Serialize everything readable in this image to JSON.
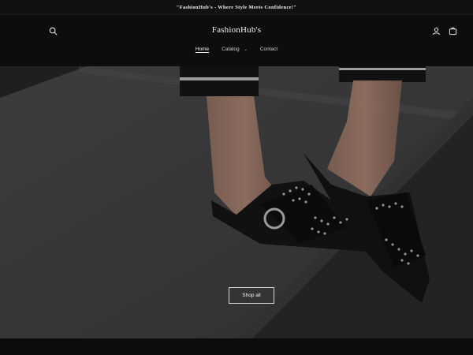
{
  "announcement": {
    "text": "\"FashionHub's - Where Style Meets Confidence!\""
  },
  "header": {
    "logo": "FashionHub's",
    "icons": {
      "search": "search-icon",
      "account": "account-icon",
      "cart": "cart-icon"
    }
  },
  "nav": {
    "items": [
      {
        "label": "Home",
        "active": true
      },
      {
        "label": "Catalog",
        "has_dropdown": true
      },
      {
        "label": "Contact"
      }
    ]
  },
  "hero": {
    "cta_label": "Shop all",
    "image_description_icon": "studded-mule-shoes-image"
  },
  "colors": {
    "background": "#0f0f0f",
    "text": "#f0f0f0",
    "hero_overlay": "#000000"
  }
}
